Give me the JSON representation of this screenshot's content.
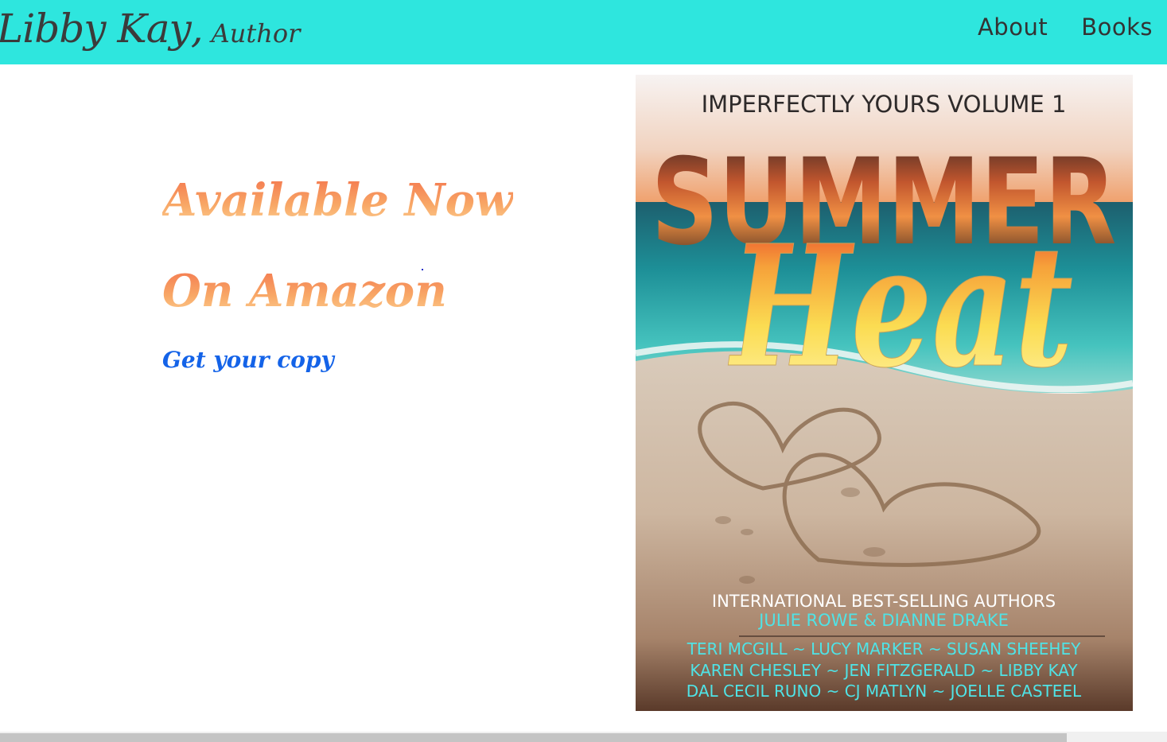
{
  "header": {
    "brand_name": "Libby Kay",
    "brand_comma": ",",
    "brand_role": "Author",
    "nav": [
      {
        "label": "About"
      },
      {
        "label": "Books"
      }
    ],
    "background_color": "#2ee6de"
  },
  "promo": {
    "line1": "Available Now",
    "line2": "On Amazon",
    "cta_label": "Get your copy"
  },
  "cover": {
    "series_title": "IMPERFECTLY YOURS VOLUME 1",
    "title_main": "SUMMER",
    "title_script": "Heat",
    "tagline": "INTERNATIONAL BEST-SELLING AUTHORS",
    "lead_authors": "JULIE ROWE & DIANNE DRAKE",
    "authors_line1": "TERI MCGILL ~ LUCY MARKER ~ SUSAN SHEEHEY",
    "authors_line2": "KAREN CHESLEY ~ JEN FITZGERALD ~ LIBBY KAY",
    "authors_line3": "DAL CECIL RUNO ~ CJ MATLYN ~ JOELLE CASTEEL"
  },
  "scrollbar": {
    "thumb_fraction": 0.914
  }
}
